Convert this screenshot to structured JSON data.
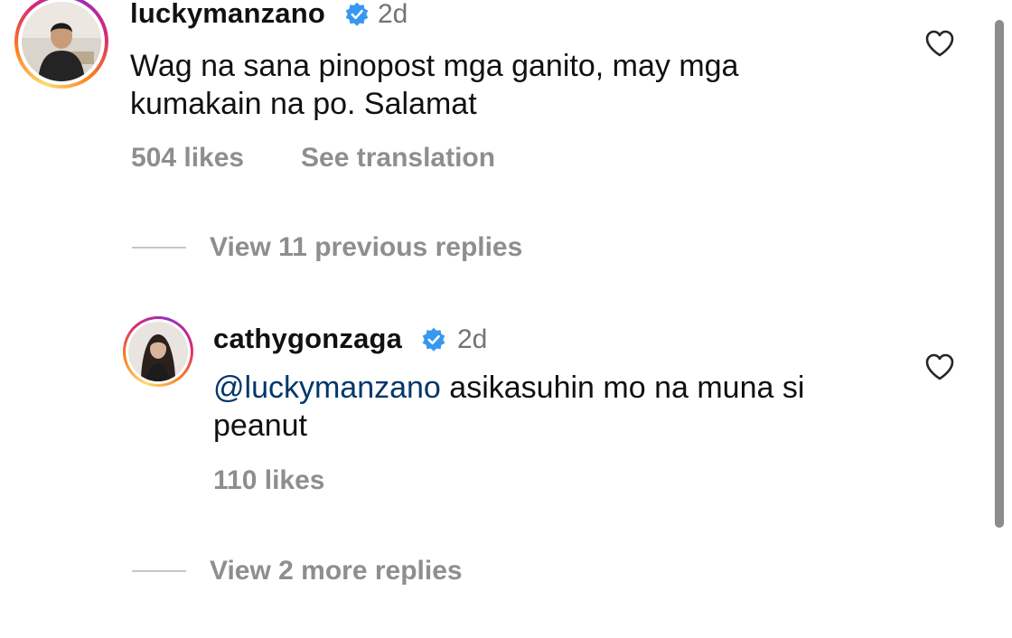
{
  "comment": {
    "username": "luckymanzano",
    "time": "2d",
    "text": "Wag na sana pinopost mga ganito, may mga kumakain na po. Salamat",
    "likes": "504 likes",
    "see_translation": "See translation",
    "view_previous_replies": "View 11 previous replies"
  },
  "reply": {
    "username": "cathygonzaga",
    "time": "2d",
    "mention": "@luckymanzano",
    "text": " asikasuhin mo na muna si peanut",
    "likes": "110 likes",
    "view_more_replies": "View 2 more replies"
  },
  "colors": {
    "verified_badge": "#3897f0",
    "mention": "#00376b",
    "muted": "#8e8e8e"
  },
  "icons": {
    "like": "heart-outline-icon",
    "verified": "verified-badge-icon"
  }
}
